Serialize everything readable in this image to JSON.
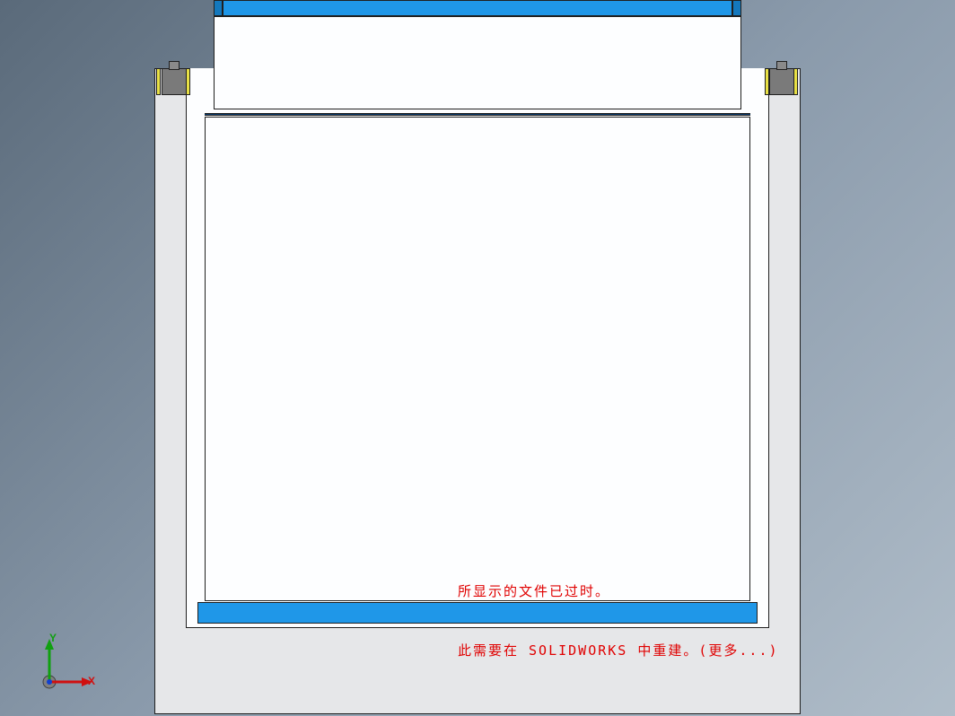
{
  "viewport": {
    "background_gradient": [
      "#5a6a7a",
      "#8a9aab",
      "#b0bdc9"
    ]
  },
  "model": {
    "colors": {
      "housing": "#e6e7e9",
      "plate_face": "#fdfeff",
      "accent_blue": "#1f97e8",
      "accent_blue_dark": "#1478bd",
      "flange_gray": "#7a7a7a",
      "flange_yellow": "#e8e045",
      "edge": "#202020"
    }
  },
  "triad": {
    "axes": {
      "x": {
        "label": "X",
        "color": "#d01010"
      },
      "y": {
        "label": "Y",
        "color": "#10a010"
      },
      "z": {
        "label": "",
        "color": "#1040d0"
      }
    },
    "origin_color": "#808080"
  },
  "warning": {
    "line1": "所显示的文件已过时。",
    "line2": "此需要在 SOLIDWORKS 中重建。(更多...)"
  }
}
